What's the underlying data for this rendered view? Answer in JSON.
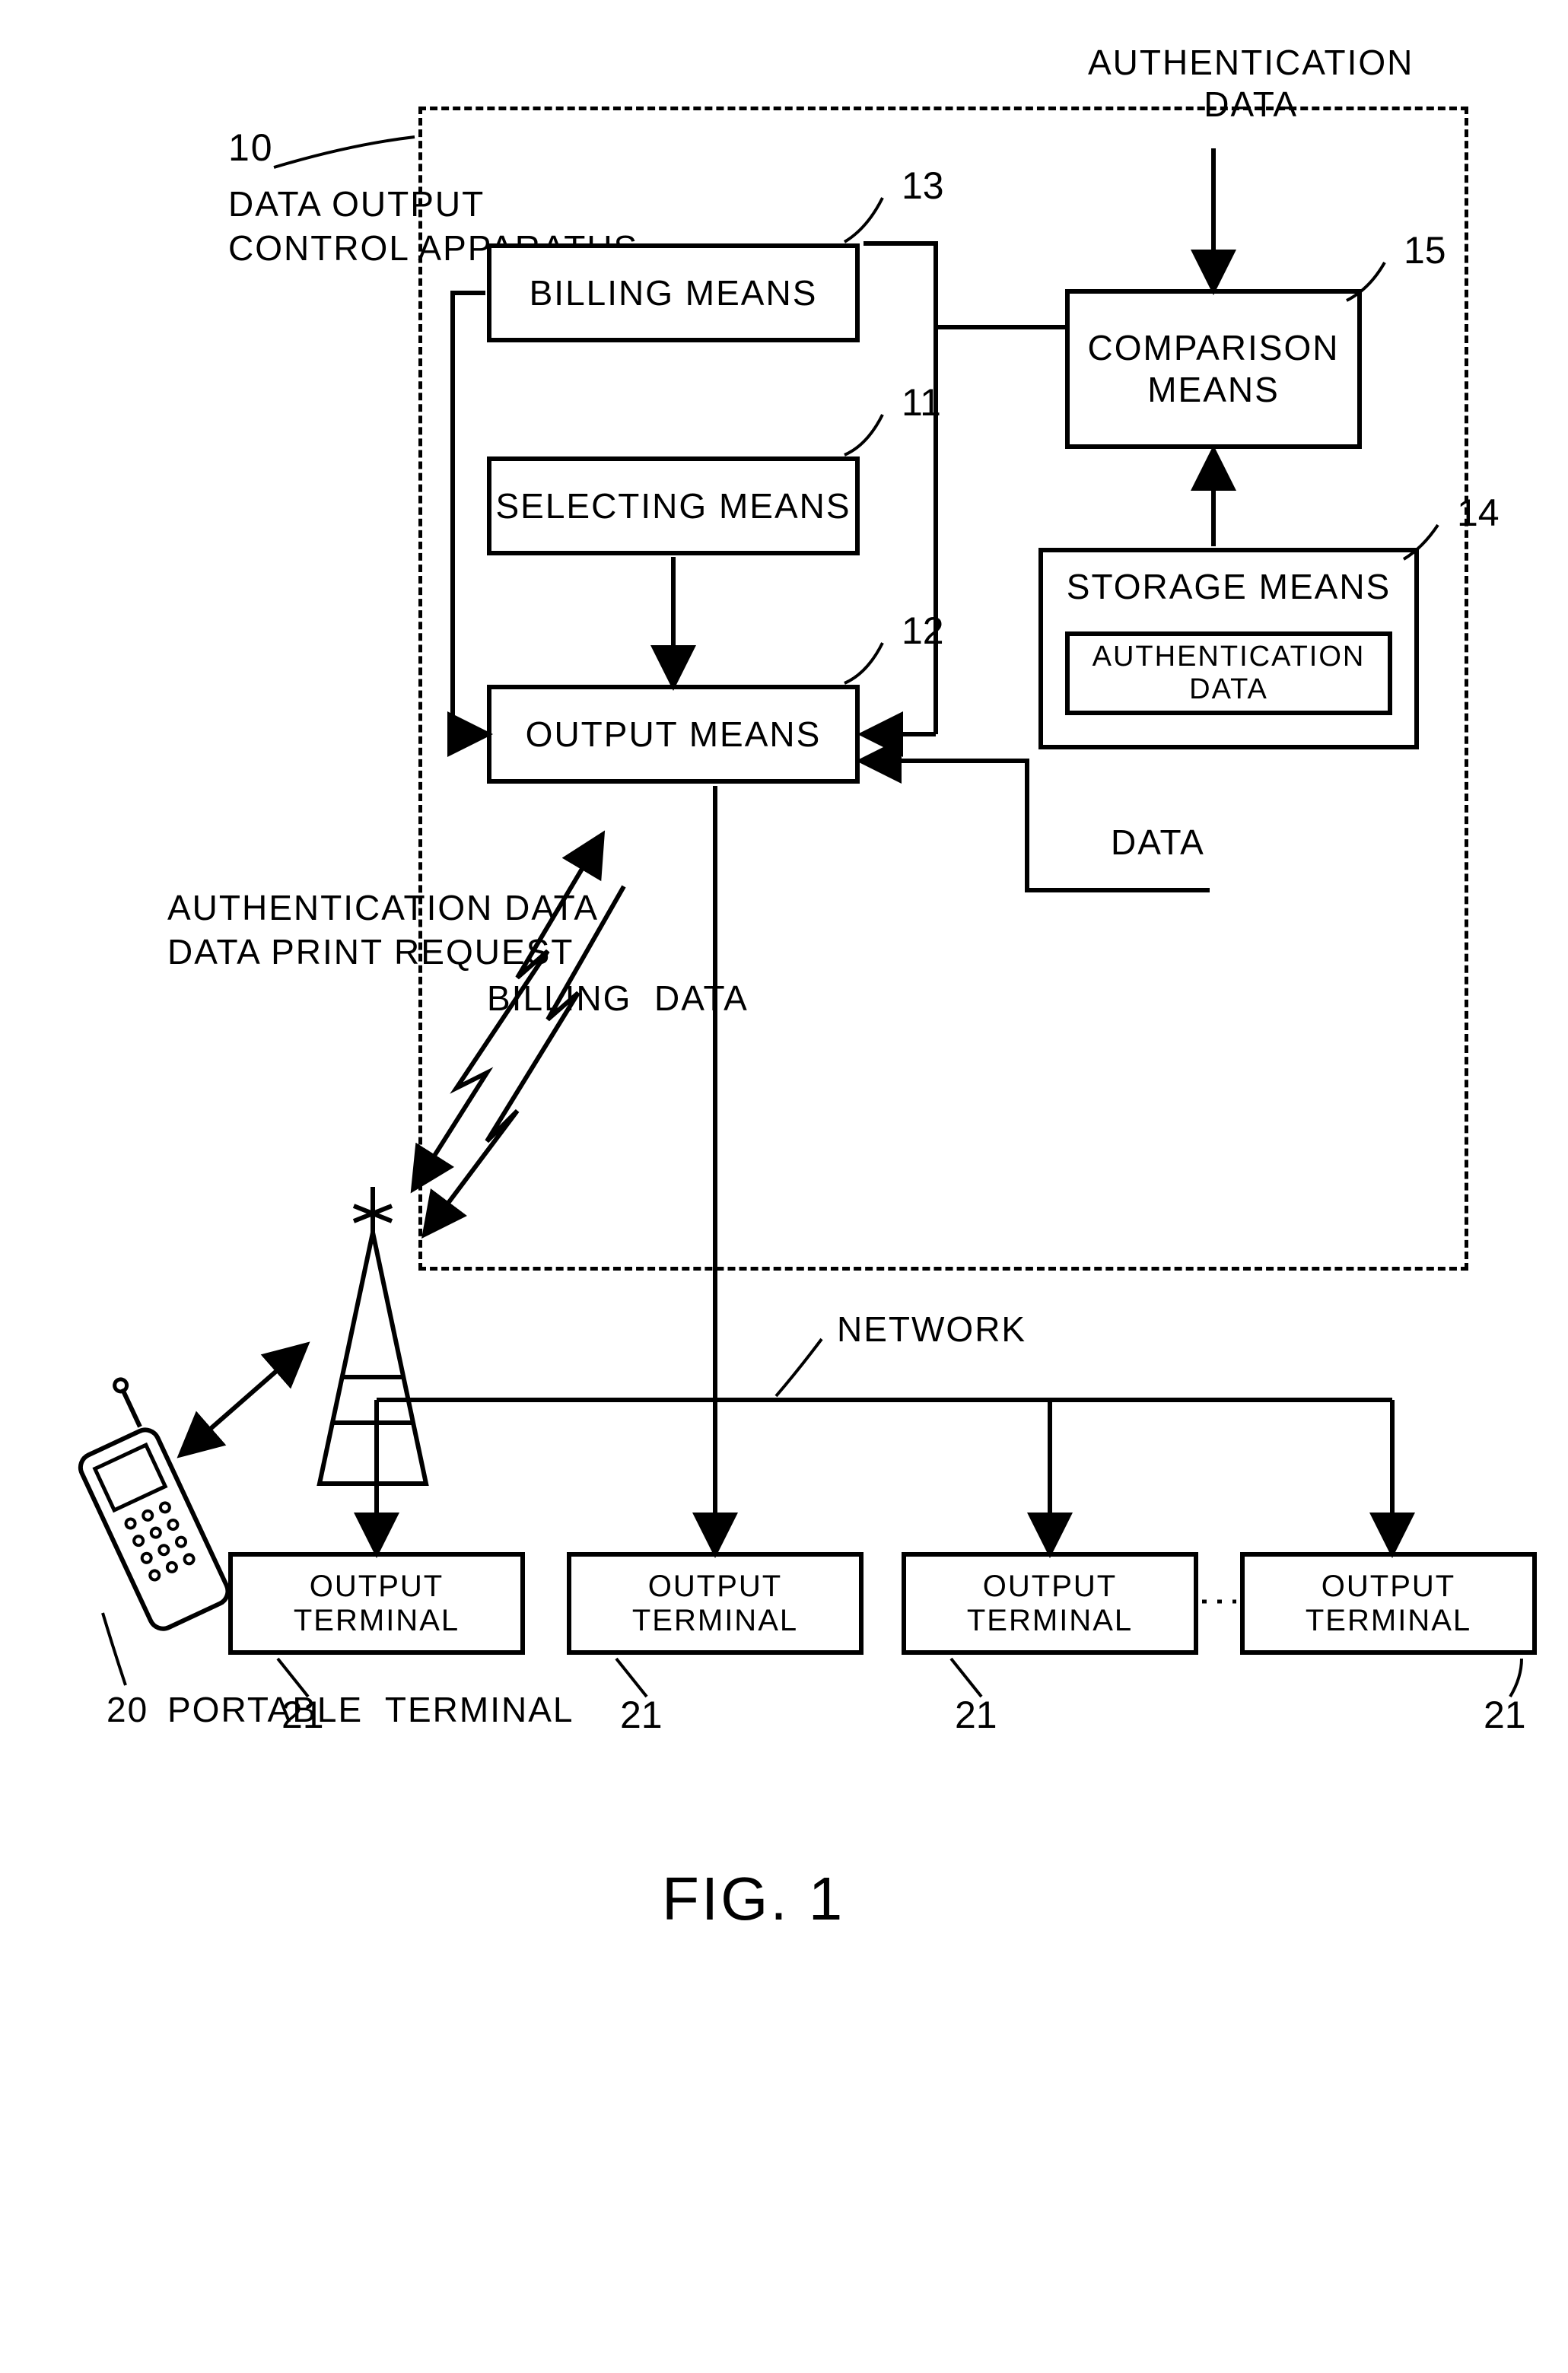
{
  "figure": {
    "label": "FIG. 1",
    "apparatus_ref": "10",
    "apparatus_name": "DATA OUTPUT\nCONTROL APPARATUS",
    "portable_ref": "20",
    "portable_name": "PORTABLE  TERMINAL",
    "blocks": {
      "billing": {
        "label": "BILLING  MEANS",
        "ref": "13"
      },
      "selecting": {
        "label": "SELECTING  MEANS",
        "ref": "11"
      },
      "output": {
        "label": "OUTPUT  MEANS",
        "ref": "12"
      },
      "comparison": {
        "label": "COMPARISON\nMEANS",
        "ref": "15"
      },
      "storage": {
        "label": "STORAGE  MEANS",
        "ref": "14"
      },
      "auth_data_inner": "AUTHENTICATION DATA"
    },
    "signals": {
      "auth_in": "AUTHENTICATION\nDATA",
      "data_in": "DATA",
      "billing_data": "BILLING  DATA",
      "phone_up": "AUTHENTICATION DATA\nDATA PRINT REQUEST"
    },
    "network": {
      "label": "NETWORK",
      "terminal_label": "OUTPUT TERMINAL",
      "terminal_ref": "21"
    }
  },
  "chart_data": {
    "type": "diagram",
    "title": "FIG. 1",
    "nodes": [
      {
        "id": "10",
        "label": "DATA OUTPUT CONTROL APPARATUS",
        "kind": "container"
      },
      {
        "id": "13",
        "label": "BILLING MEANS",
        "parent": "10"
      },
      {
        "id": "11",
        "label": "SELECTING MEANS",
        "parent": "10"
      },
      {
        "id": "12",
        "label": "OUTPUT MEANS",
        "parent": "10"
      },
      {
        "id": "15",
        "label": "COMPARISON MEANS",
        "parent": "10"
      },
      {
        "id": "14",
        "label": "STORAGE MEANS",
        "parent": "10",
        "contains": "AUTHENTICATION DATA"
      },
      {
        "id": "20",
        "label": "PORTABLE TERMINAL"
      },
      {
        "id": "21a",
        "label": "OUTPUT TERMINAL"
      },
      {
        "id": "21b",
        "label": "OUTPUT TERMINAL"
      },
      {
        "id": "21c",
        "label": "OUTPUT TERMINAL"
      },
      {
        "id": "21d",
        "label": "OUTPUT TERMINAL"
      },
      {
        "id": "network",
        "label": "NETWORK",
        "kind": "bus"
      }
    ],
    "edges": [
      {
        "from": "external",
        "to": "15",
        "label": "AUTHENTICATION DATA"
      },
      {
        "from": "14",
        "to": "15"
      },
      {
        "from": "15",
        "to": "13"
      },
      {
        "from": "15",
        "to": "12"
      },
      {
        "from": "13",
        "to": "12"
      },
      {
        "from": "11",
        "to": "12"
      },
      {
        "from": "external",
        "to": "12",
        "label": "DATA"
      },
      {
        "from": "20",
        "to": "12",
        "label": "AUTHENTICATION DATA / DATA PRINT REQUEST",
        "bidir": true,
        "wireless": true
      },
      {
        "from": "12",
        "to": "20",
        "label": "BILLING DATA",
        "wireless": true
      },
      {
        "from": "12",
        "to": "network"
      },
      {
        "from": "network",
        "to": "21a"
      },
      {
        "from": "network",
        "to": "21b"
      },
      {
        "from": "network",
        "to": "21c"
      },
      {
        "from": "network",
        "to": "21d"
      }
    ]
  }
}
